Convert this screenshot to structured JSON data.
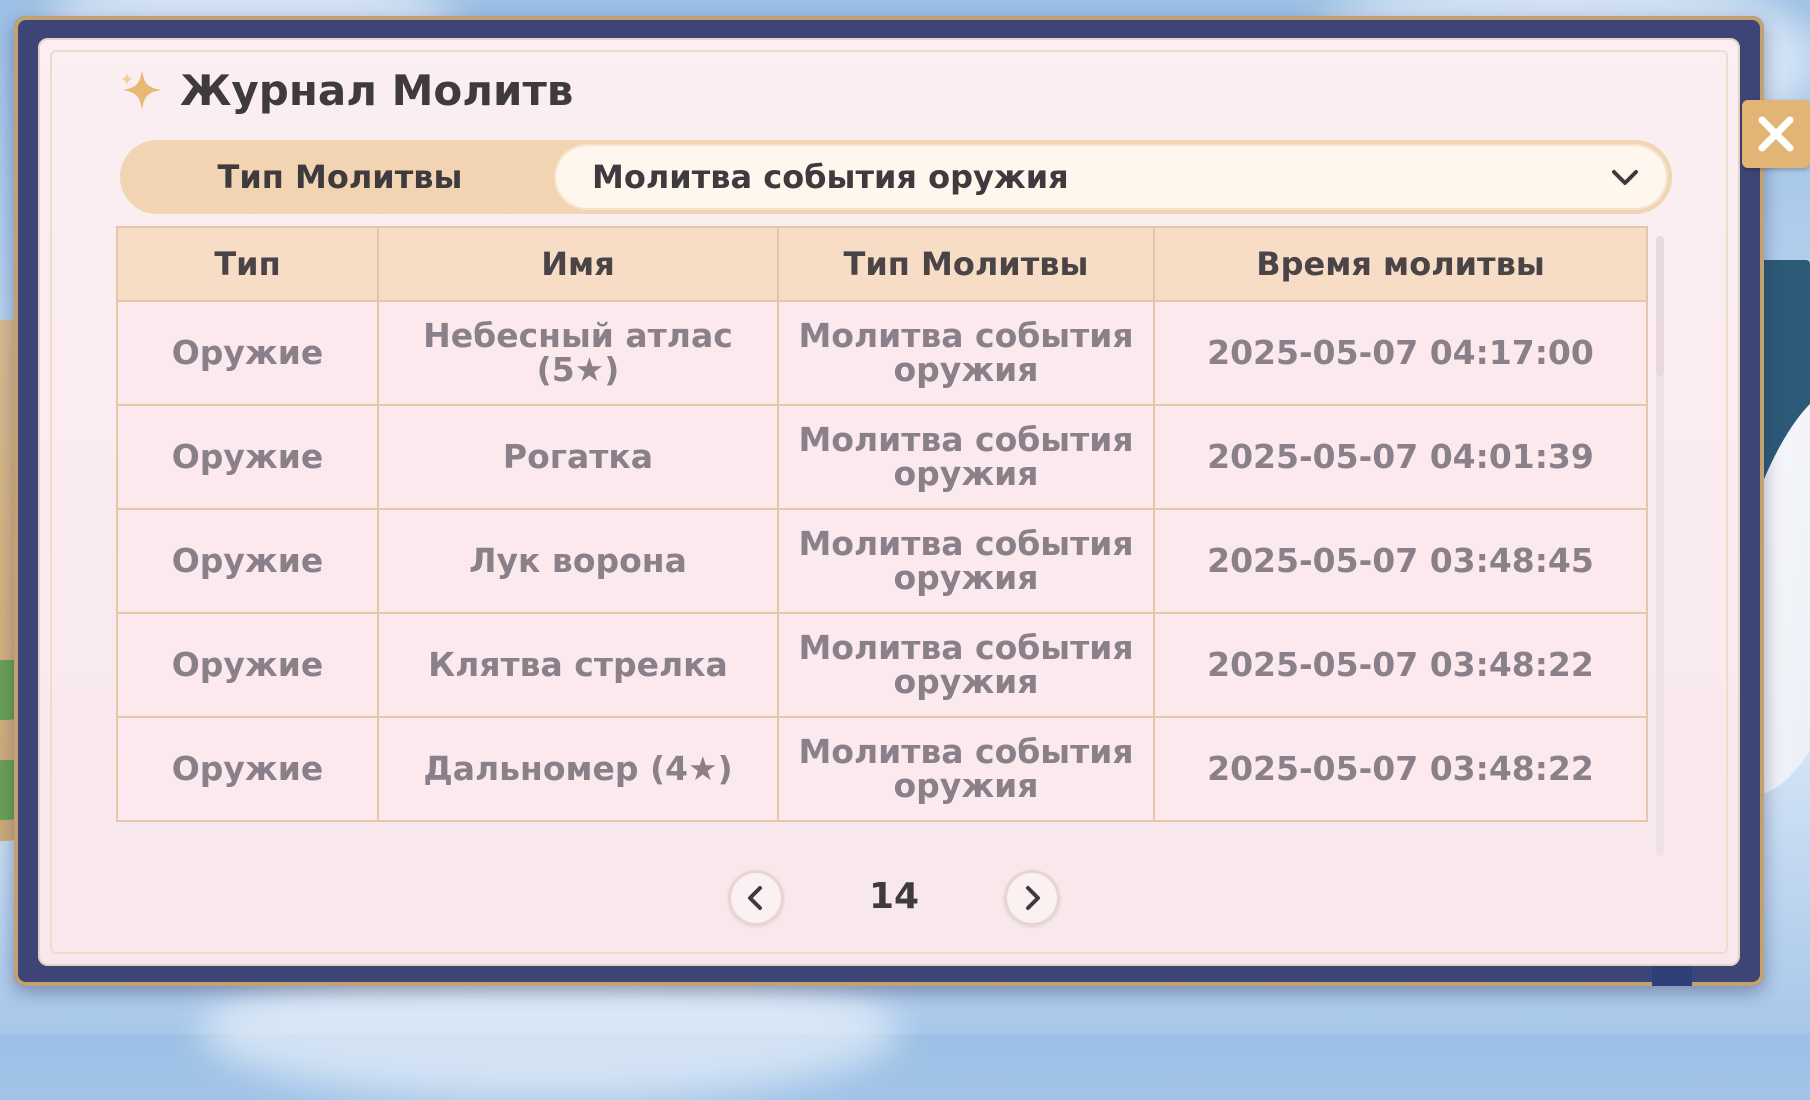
{
  "window": {
    "title": "Журнал Молитв"
  },
  "filter": {
    "label": "Тип Молитвы",
    "selected": "Молитва события оружия"
  },
  "table": {
    "headers": [
      "Тип",
      "Имя",
      "Тип Молитвы",
      "Время молитвы"
    ],
    "rows": [
      {
        "type": "Оружие",
        "name": "Небесный атлас (5★)",
        "banner": "Молитва события оружия",
        "time": "2025-05-07 04:17:00"
      },
      {
        "type": "Оружие",
        "name": "Рогатка",
        "banner": "Молитва события оружия",
        "time": "2025-05-07 04:01:39"
      },
      {
        "type": "Оружие",
        "name": "Лук ворона",
        "banner": "Молитва события оружия",
        "time": "2025-05-07 03:48:45"
      },
      {
        "type": "Оружие",
        "name": "Клятва стрелка",
        "banner": "Молитва события оружия",
        "time": "2025-05-07 03:48:22"
      },
      {
        "type": "Оружие",
        "name": "Дальномер (4★)",
        "banner": "Молитва события оружия",
        "time": "2025-05-07 03:48:22"
      }
    ]
  },
  "pagination": {
    "page": "14"
  },
  "colors": {
    "five_star": "#c2572a",
    "four_star": "#9a3ee0",
    "accent": "#e2b574"
  },
  "icons": {
    "title": "sparkle-icon",
    "close": "close-icon",
    "dropdown": "chevron-down-icon",
    "prev": "chevron-left-icon",
    "next": "chevron-right-icon"
  }
}
